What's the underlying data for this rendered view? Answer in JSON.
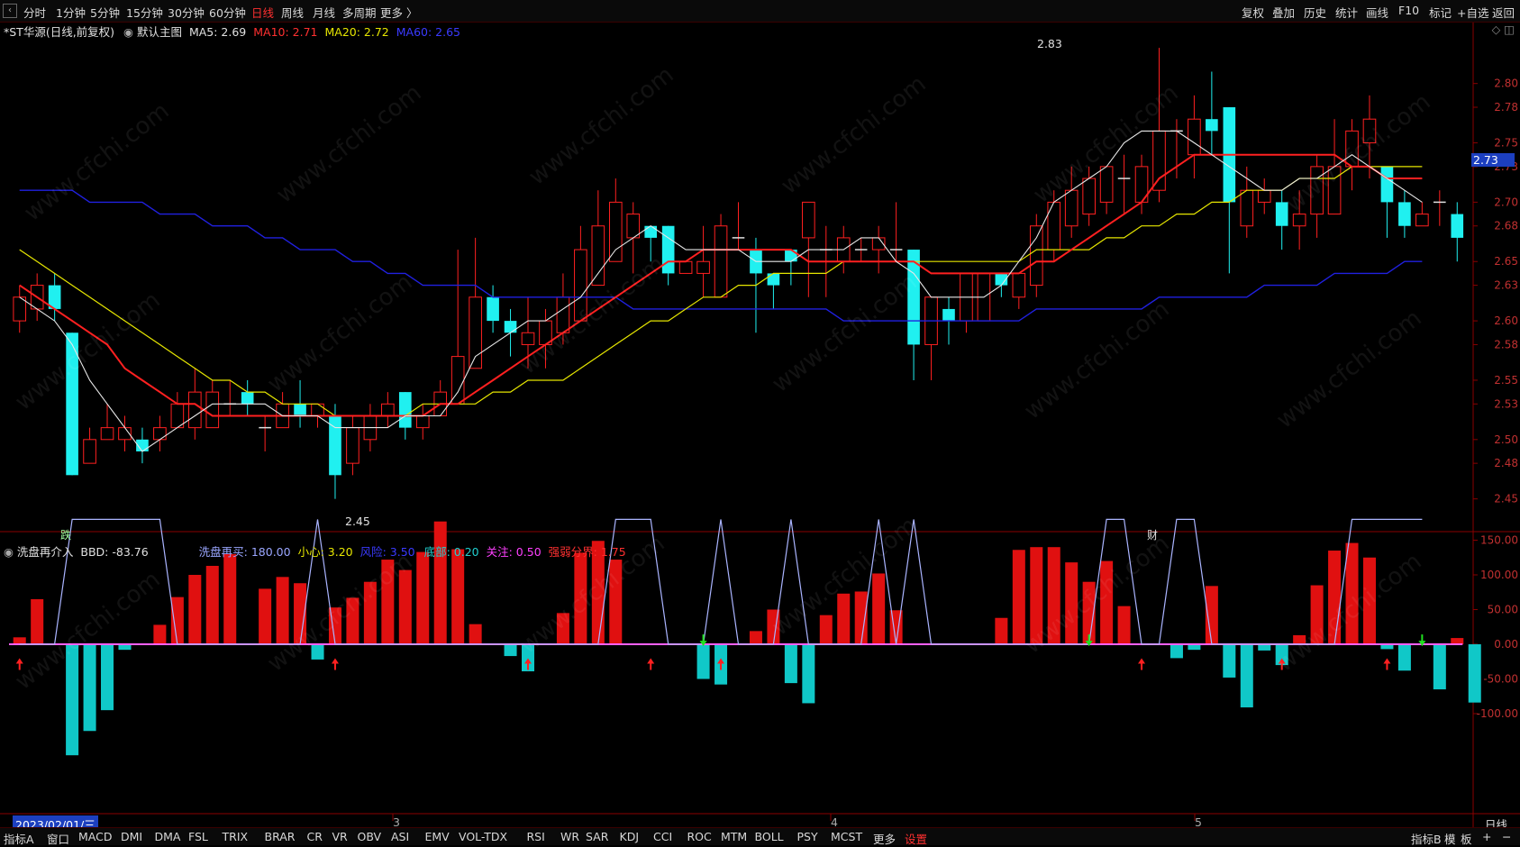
{
  "top_nav": {
    "items": [
      "分时",
      "1分钟",
      "5分钟",
      "15分钟",
      "30分钟",
      "60分钟",
      "日线",
      "周线",
      "月线",
      "多周期",
      "更多 〉"
    ],
    "active": "日线",
    "tools": [
      "复权",
      "叠加",
      "历史",
      "统计",
      "画线",
      "F10",
      "标记",
      "+自选",
      "返回"
    ]
  },
  "main_header": {
    "stock": "*ST华源(日线,前复权)",
    "chart_name": "默认主图",
    "ma5": "MA5: 2.69",
    "ma10": "MA10: 2.71",
    "ma20": "MA20: 2.72",
    "ma60": "MA60: 2.65"
  },
  "sub_header": {
    "name": "洗盘再介入",
    "bbd": "BBD: -83.76",
    "p1": "洗盘再买: 180.00",
    "p2": "小心: 3.20",
    "p3": "风险: 3.50",
    "p4": "底部: 0.20",
    "p5": "关注: 0.50",
    "p6": "强弱分界: 1.75"
  },
  "annotations": {
    "high": "2.83",
    "low": "2.45",
    "marker_left": "跌",
    "marker_right": "财",
    "current_price": "2.73",
    "date": "2023/02/01/三",
    "period_label": "日线",
    "months": [
      "3",
      "4",
      "5"
    ]
  },
  "price_axis": [
    "2.80",
    "2.78",
    "2.75",
    "2.73",
    "2.70",
    "2.68",
    "2.65",
    "2.63",
    "2.60",
    "2.58",
    "2.55",
    "2.53",
    "2.50",
    "2.48",
    "2.45"
  ],
  "ind_axis": [
    "150.00",
    "100.00",
    "50.00",
    "0.00",
    "-50.00",
    "-100.00"
  ],
  "bottom_tabs": [
    "指标A",
    "窗口",
    "MACD",
    "DMI",
    "DMA",
    "FSL",
    "TRIX",
    "BRAR",
    "CR",
    "VR",
    "OBV",
    "ASI",
    "EMV",
    "VOL-TDX",
    "RSI",
    "WR",
    "SAR",
    "KDJ",
    "CCI",
    "ROC",
    "MTM",
    "BOLL",
    "PSY",
    "MCST",
    "更多",
    "设置"
  ],
  "bottom_right": [
    "指标B",
    "模",
    "板",
    "+",
    "−"
  ],
  "watermark": "www.cfchi.com",
  "colors": {
    "up": "#ff2020",
    "down": "#20f0f0",
    "ma5": "#e8e8e8",
    "ma10": "#ff2020",
    "ma20": "#e6e600",
    "ma60": "#2020e0",
    "axis": "#8a0000"
  },
  "chart_data": {
    "type": "candlestick",
    "y_range": [
      2.43,
      2.84
    ],
    "candles": [
      {
        "o": 2.6,
        "c": 2.62,
        "h": 2.63,
        "l": 2.59
      },
      {
        "o": 2.61,
        "c": 2.63,
        "h": 2.64,
        "l": 2.6
      },
      {
        "o": 2.63,
        "c": 2.61,
        "h": 2.64,
        "l": 2.6
      },
      {
        "o": 2.59,
        "c": 2.47,
        "h": 2.59,
        "l": 2.47
      },
      {
        "o": 2.48,
        "c": 2.5,
        "h": 2.51,
        "l": 2.48
      },
      {
        "o": 2.5,
        "c": 2.51,
        "h": 2.53,
        "l": 2.5
      },
      {
        "o": 2.5,
        "c": 2.51,
        "h": 2.52,
        "l": 2.49
      },
      {
        "o": 2.5,
        "c": 2.49,
        "h": 2.51,
        "l": 2.48
      },
      {
        "o": 2.5,
        "c": 2.51,
        "h": 2.52,
        "l": 2.49
      },
      {
        "o": 2.51,
        "c": 2.53,
        "h": 2.54,
        "l": 2.51
      },
      {
        "o": 2.51,
        "c": 2.54,
        "h": 2.56,
        "l": 2.5
      },
      {
        "o": 2.51,
        "c": 2.54,
        "h": 2.55,
        "l": 2.51
      },
      {
        "o": 2.53,
        "c": 2.53,
        "h": 2.55,
        "l": 2.52
      },
      {
        "o": 2.54,
        "c": 2.53,
        "h": 2.55,
        "l": 2.52
      },
      {
        "o": 2.51,
        "c": 2.51,
        "h": 2.52,
        "l": 2.49
      },
      {
        "o": 2.51,
        "c": 2.53,
        "h": 2.54,
        "l": 2.51
      },
      {
        "o": 2.53,
        "c": 2.52,
        "h": 2.55,
        "l": 2.51
      },
      {
        "o": 2.52,
        "c": 2.53,
        "h": 2.53,
        "l": 2.51
      },
      {
        "o": 2.52,
        "c": 2.47,
        "h": 2.53,
        "l": 2.45
      },
      {
        "o": 2.48,
        "c": 2.51,
        "h": 2.52,
        "l": 2.47
      },
      {
        "o": 2.5,
        "c": 2.52,
        "h": 2.53,
        "l": 2.49
      },
      {
        "o": 2.52,
        "c": 2.53,
        "h": 2.54,
        "l": 2.51
      },
      {
        "o": 2.54,
        "c": 2.51,
        "h": 2.54,
        "l": 2.5
      },
      {
        "o": 2.51,
        "c": 2.52,
        "h": 2.53,
        "l": 2.5
      },
      {
        "o": 2.52,
        "c": 2.54,
        "h": 2.55,
        "l": 2.52
      },
      {
        "o": 2.53,
        "c": 2.57,
        "h": 2.66,
        "l": 2.53
      },
      {
        "o": 2.56,
        "c": 2.62,
        "h": 2.67,
        "l": 2.56
      },
      {
        "o": 2.62,
        "c": 2.6,
        "h": 2.63,
        "l": 2.59
      },
      {
        "o": 2.6,
        "c": 2.59,
        "h": 2.61,
        "l": 2.57
      },
      {
        "o": 2.58,
        "c": 2.59,
        "h": 2.62,
        "l": 2.56
      },
      {
        "o": 2.58,
        "c": 2.6,
        "h": 2.61,
        "l": 2.56
      },
      {
        "o": 2.59,
        "c": 2.62,
        "h": 2.64,
        "l": 2.58
      },
      {
        "o": 2.6,
        "c": 2.66,
        "h": 2.68,
        "l": 2.6
      },
      {
        "o": 2.63,
        "c": 2.68,
        "h": 2.71,
        "l": 2.63
      },
      {
        "o": 2.65,
        "c": 2.7,
        "h": 2.72,
        "l": 2.65
      },
      {
        "o": 2.67,
        "c": 2.69,
        "h": 2.7,
        "l": 2.64
      },
      {
        "o": 2.68,
        "c": 2.67,
        "h": 2.68,
        "l": 2.65
      },
      {
        "o": 2.68,
        "c": 2.64,
        "h": 2.68,
        "l": 2.63
      },
      {
        "o": 2.64,
        "c": 2.65,
        "h": 2.65,
        "l": 2.64
      },
      {
        "o": 2.64,
        "c": 2.65,
        "h": 2.68,
        "l": 2.62
      },
      {
        "o": 2.62,
        "c": 2.68,
        "h": 2.69,
        "l": 2.62
      },
      {
        "o": 2.67,
        "c": 2.67,
        "h": 2.7,
        "l": 2.66
      },
      {
        "o": 2.66,
        "c": 2.64,
        "h": 2.67,
        "l": 2.59
      },
      {
        "o": 2.64,
        "c": 2.63,
        "h": 2.64,
        "l": 2.61
      },
      {
        "o": 2.66,
        "c": 2.65,
        "h": 2.66,
        "l": 2.63
      },
      {
        "o": 2.67,
        "c": 2.7,
        "h": 2.7,
        "l": 2.62
      },
      {
        "o": 2.66,
        "c": 2.66,
        "h": 2.68,
        "l": 2.62
      },
      {
        "o": 2.65,
        "c": 2.67,
        "h": 2.68,
        "l": 2.64
      },
      {
        "o": 2.66,
        "c": 2.66,
        "h": 2.67,
        "l": 2.65
      },
      {
        "o": 2.66,
        "c": 2.67,
        "h": 2.68,
        "l": 2.64
      },
      {
        "o": 2.66,
        "c": 2.66,
        "h": 2.7,
        "l": 2.65
      },
      {
        "o": 2.66,
        "c": 2.58,
        "h": 2.66,
        "l": 2.55
      },
      {
        "o": 2.58,
        "c": 2.62,
        "h": 2.62,
        "l": 2.55
      },
      {
        "o": 2.61,
        "c": 2.6,
        "h": 2.62,
        "l": 2.58
      },
      {
        "o": 2.6,
        "c": 2.64,
        "h": 2.64,
        "l": 2.59
      },
      {
        "o": 2.6,
        "c": 2.64,
        "h": 2.64,
        "l": 2.6
      },
      {
        "o": 2.64,
        "c": 2.63,
        "h": 2.64,
        "l": 2.62
      },
      {
        "o": 2.62,
        "c": 2.64,
        "h": 2.64,
        "l": 2.61
      },
      {
        "o": 2.63,
        "c": 2.68,
        "h": 2.69,
        "l": 2.62
      },
      {
        "o": 2.66,
        "c": 2.7,
        "h": 2.71,
        "l": 2.65
      },
      {
        "o": 2.68,
        "c": 2.71,
        "h": 2.73,
        "l": 2.67
      },
      {
        "o": 2.69,
        "c": 2.72,
        "h": 2.73,
        "l": 2.68
      },
      {
        "o": 2.7,
        "c": 2.73,
        "h": 2.73,
        "l": 2.69
      },
      {
        "o": 2.72,
        "c": 2.72,
        "h": 2.74,
        "l": 2.69
      },
      {
        "o": 2.7,
        "c": 2.73,
        "h": 2.74,
        "l": 2.69
      },
      {
        "o": 2.71,
        "c": 2.76,
        "h": 2.83,
        "l": 2.7
      },
      {
        "o": 2.76,
        "c": 2.76,
        "h": 2.77,
        "l": 2.72
      },
      {
        "o": 2.74,
        "c": 2.77,
        "h": 2.79,
        "l": 2.72
      },
      {
        "o": 2.77,
        "c": 2.76,
        "h": 2.81,
        "l": 2.74
      },
      {
        "o": 2.78,
        "c": 2.7,
        "h": 2.78,
        "l": 2.64
      },
      {
        "o": 2.68,
        "c": 2.71,
        "h": 2.73,
        "l": 2.67
      },
      {
        "o": 2.7,
        "c": 2.71,
        "h": 2.72,
        "l": 2.69
      },
      {
        "o": 2.7,
        "c": 2.68,
        "h": 2.71,
        "l": 2.66
      },
      {
        "o": 2.68,
        "c": 2.69,
        "h": 2.71,
        "l": 2.66
      },
      {
        "o": 2.69,
        "c": 2.73,
        "h": 2.74,
        "l": 2.67
      },
      {
        "o": 2.69,
        "c": 2.73,
        "h": 2.77,
        "l": 2.69
      },
      {
        "o": 2.73,
        "c": 2.76,
        "h": 2.77,
        "l": 2.71
      },
      {
        "o": 2.75,
        "c": 2.77,
        "h": 2.79,
        "l": 2.72
      },
      {
        "o": 2.73,
        "c": 2.7,
        "h": 2.73,
        "l": 2.67
      },
      {
        "o": 2.7,
        "c": 2.68,
        "h": 2.71,
        "l": 2.67
      },
      {
        "o": 2.68,
        "c": 2.69,
        "h": 2.7,
        "l": 2.68
      },
      {
        "o": 2.7,
        "c": 2.7,
        "h": 2.71,
        "l": 2.68
      },
      {
        "o": 2.69,
        "c": 2.67,
        "h": 2.7,
        "l": 2.65
      }
    ],
    "ma5": [
      2.62,
      2.61,
      2.6,
      2.58,
      2.55,
      2.53,
      2.51,
      2.49,
      2.5,
      2.51,
      2.52,
      2.53,
      2.53,
      2.53,
      2.53,
      2.52,
      2.52,
      2.52,
      2.51,
      2.51,
      2.51,
      2.51,
      2.52,
      2.52,
      2.52,
      2.54,
      2.57,
      2.58,
      2.59,
      2.6,
      2.6,
      2.61,
      2.62,
      2.64,
      2.66,
      2.67,
      2.68,
      2.67,
      2.66,
      2.66,
      2.66,
      2.66,
      2.65,
      2.65,
      2.65,
      2.66,
      2.66,
      2.66,
      2.67,
      2.67,
      2.65,
      2.64,
      2.62,
      2.62,
      2.62,
      2.62,
      2.63,
      2.65,
      2.67,
      2.7,
      2.71,
      2.72,
      2.73,
      2.75,
      2.76,
      2.76,
      2.76,
      2.75,
      2.74,
      2.73,
      2.72,
      2.71,
      2.71,
      2.72,
      2.72,
      2.73,
      2.74,
      2.73,
      2.72,
      2.71,
      2.7
    ],
    "ma10": [
      2.63,
      2.62,
      2.61,
      2.6,
      2.59,
      2.58,
      2.56,
      2.55,
      2.54,
      2.53,
      2.53,
      2.52,
      2.52,
      2.52,
      2.52,
      2.52,
      2.52,
      2.52,
      2.52,
      2.52,
      2.52,
      2.52,
      2.52,
      2.52,
      2.53,
      2.53,
      2.54,
      2.55,
      2.56,
      2.57,
      2.58,
      2.59,
      2.6,
      2.61,
      2.62,
      2.63,
      2.64,
      2.65,
      2.65,
      2.66,
      2.66,
      2.66,
      2.66,
      2.66,
      2.66,
      2.65,
      2.65,
      2.65,
      2.65,
      2.65,
      2.65,
      2.65,
      2.64,
      2.64,
      2.64,
      2.64,
      2.64,
      2.64,
      2.65,
      2.65,
      2.66,
      2.67,
      2.68,
      2.69,
      2.7,
      2.72,
      2.73,
      2.74,
      2.74,
      2.74,
      2.74,
      2.74,
      2.74,
      2.74,
      2.74,
      2.74,
      2.73,
      2.73,
      2.72,
      2.72,
      2.72
    ],
    "ma20": [
      2.66,
      2.65,
      2.64,
      2.63,
      2.62,
      2.61,
      2.6,
      2.59,
      2.58,
      2.57,
      2.56,
      2.55,
      2.55,
      2.54,
      2.54,
      2.53,
      2.53,
      2.53,
      2.52,
      2.52,
      2.52,
      2.52,
      2.52,
      2.53,
      2.53,
      2.53,
      2.53,
      2.54,
      2.54,
      2.55,
      2.55,
      2.55,
      2.56,
      2.57,
      2.58,
      2.59,
      2.6,
      2.6,
      2.61,
      2.62,
      2.62,
      2.63,
      2.63,
      2.64,
      2.64,
      2.64,
      2.64,
      2.65,
      2.65,
      2.65,
      2.65,
      2.65,
      2.65,
      2.65,
      2.65,
      2.65,
      2.65,
      2.65,
      2.66,
      2.66,
      2.66,
      2.66,
      2.67,
      2.67,
      2.68,
      2.68,
      2.69,
      2.69,
      2.7,
      2.7,
      2.71,
      2.71,
      2.71,
      2.72,
      2.72,
      2.72,
      2.73,
      2.73,
      2.73,
      2.73,
      2.73
    ],
    "ma60": [
      2.71,
      2.71,
      2.71,
      2.71,
      2.7,
      2.7,
      2.7,
      2.7,
      2.69,
      2.69,
      2.69,
      2.68,
      2.68,
      2.68,
      2.67,
      2.67,
      2.66,
      2.66,
      2.66,
      2.65,
      2.65,
      2.64,
      2.64,
      2.63,
      2.63,
      2.63,
      2.63,
      2.62,
      2.62,
      2.62,
      2.62,
      2.62,
      2.62,
      2.62,
      2.62,
      2.61,
      2.61,
      2.61,
      2.61,
      2.61,
      2.61,
      2.61,
      2.61,
      2.61,
      2.61,
      2.61,
      2.61,
      2.6,
      2.6,
      2.6,
      2.6,
      2.6,
      2.6,
      2.6,
      2.6,
      2.6,
      2.6,
      2.6,
      2.61,
      2.61,
      2.61,
      2.61,
      2.61,
      2.61,
      2.61,
      2.62,
      2.62,
      2.62,
      2.62,
      2.62,
      2.62,
      2.63,
      2.63,
      2.63,
      2.63,
      2.64,
      2.64,
      2.64,
      2.64,
      2.65,
      2.65
    ],
    "bbd": [
      10,
      65,
      0,
      -160,
      -125,
      -95,
      -8,
      0,
      28,
      68,
      100,
      113,
      130,
      0,
      80,
      97,
      88,
      -22,
      53,
      67,
      90,
      122,
      107,
      133,
      177,
      137,
      29,
      0,
      -17,
      -39,
      0,
      45,
      132,
      149,
      122,
      0,
      0,
      0,
      0,
      -50,
      -58,
      0,
      19,
      50,
      -56,
      -85,
      42,
      73,
      76,
      102,
      49,
      0,
      0,
      0,
      0,
      0,
      38,
      136,
      140,
      140,
      118,
      90,
      120,
      55,
      0,
      0,
      -20,
      -8,
      84,
      -48,
      -91,
      -9,
      -30,
      13,
      85,
      135,
      146,
      125,
      -7,
      -38,
      0,
      -65,
      9,
      -84
    ],
    "line_peaks": [
      [
        3,
        180
      ],
      [
        9,
        180
      ],
      [
        17,
        180
      ],
      [
        33,
        180
      ],
      [
        37,
        180
      ],
      [
        39,
        180
      ],
      [
        45,
        180
      ],
      [
        48,
        180
      ],
      [
        61,
        180
      ],
      [
        63,
        180
      ],
      [
        65,
        180
      ],
      [
        71,
        180
      ],
      [
        73,
        180
      ],
      [
        75,
        180
      ],
      [
        77,
        180
      ],
      [
        79,
        180
      ]
    ],
    "arrows_up": [
      0,
      18,
      29,
      36,
      40,
      64,
      72,
      78
    ],
    "arrows_down": [
      39,
      61,
      80
    ]
  }
}
